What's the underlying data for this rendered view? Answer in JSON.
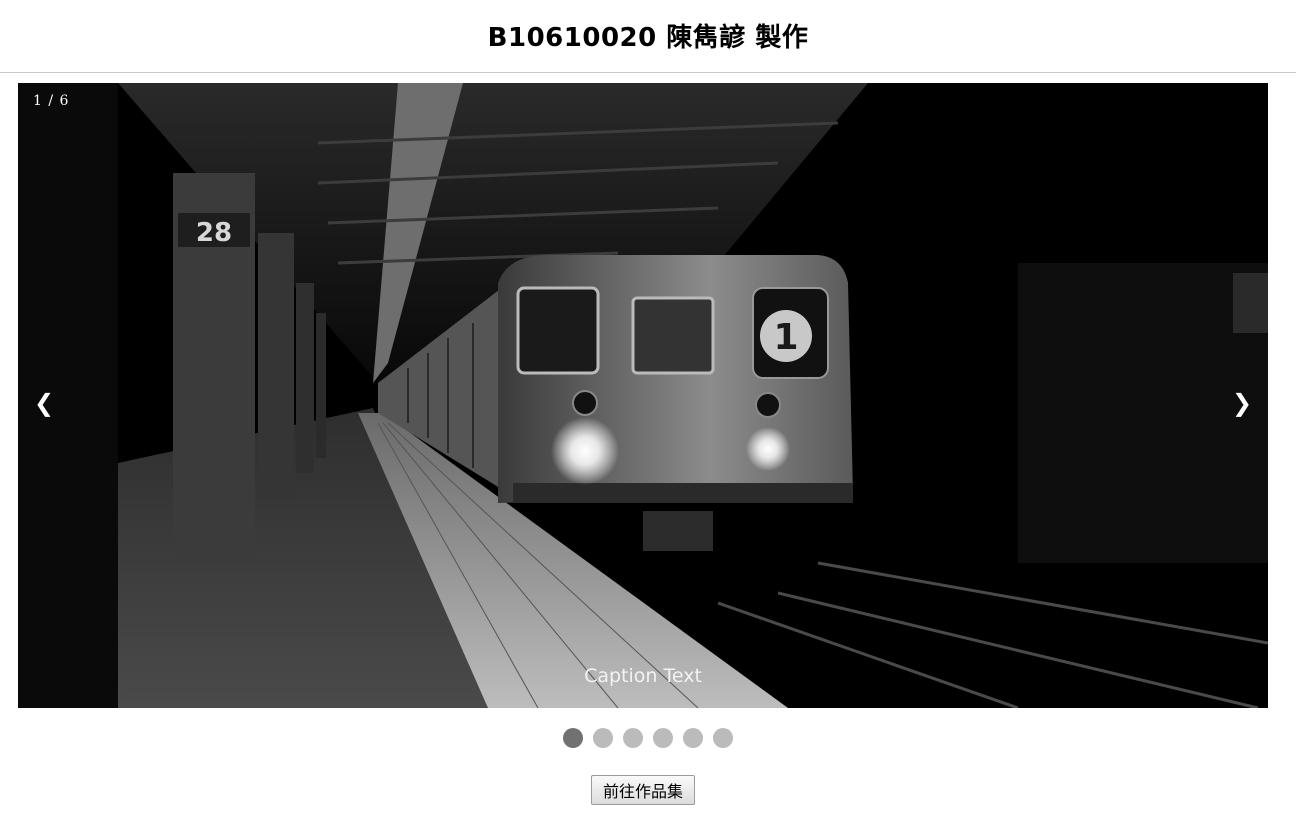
{
  "header": {
    "title": "B10610020 陳雋諺 製作"
  },
  "slideshow": {
    "counter": "1 / 6",
    "caption": "Caption Text",
    "prev_label": "❮",
    "next_label": "❯",
    "column_sign": "28",
    "train_route": "1",
    "image_subject": "subway-train-platform-photo",
    "dots": [
      {
        "active": true
      },
      {
        "active": false
      },
      {
        "active": false
      },
      {
        "active": false
      },
      {
        "active": false
      },
      {
        "active": false
      }
    ]
  },
  "footer": {
    "portfolio_button": "前往作品集"
  },
  "colors": {
    "dot_active": "#717171",
    "dot_inactive": "#bbbbbb",
    "slide_bg": "#000000"
  }
}
